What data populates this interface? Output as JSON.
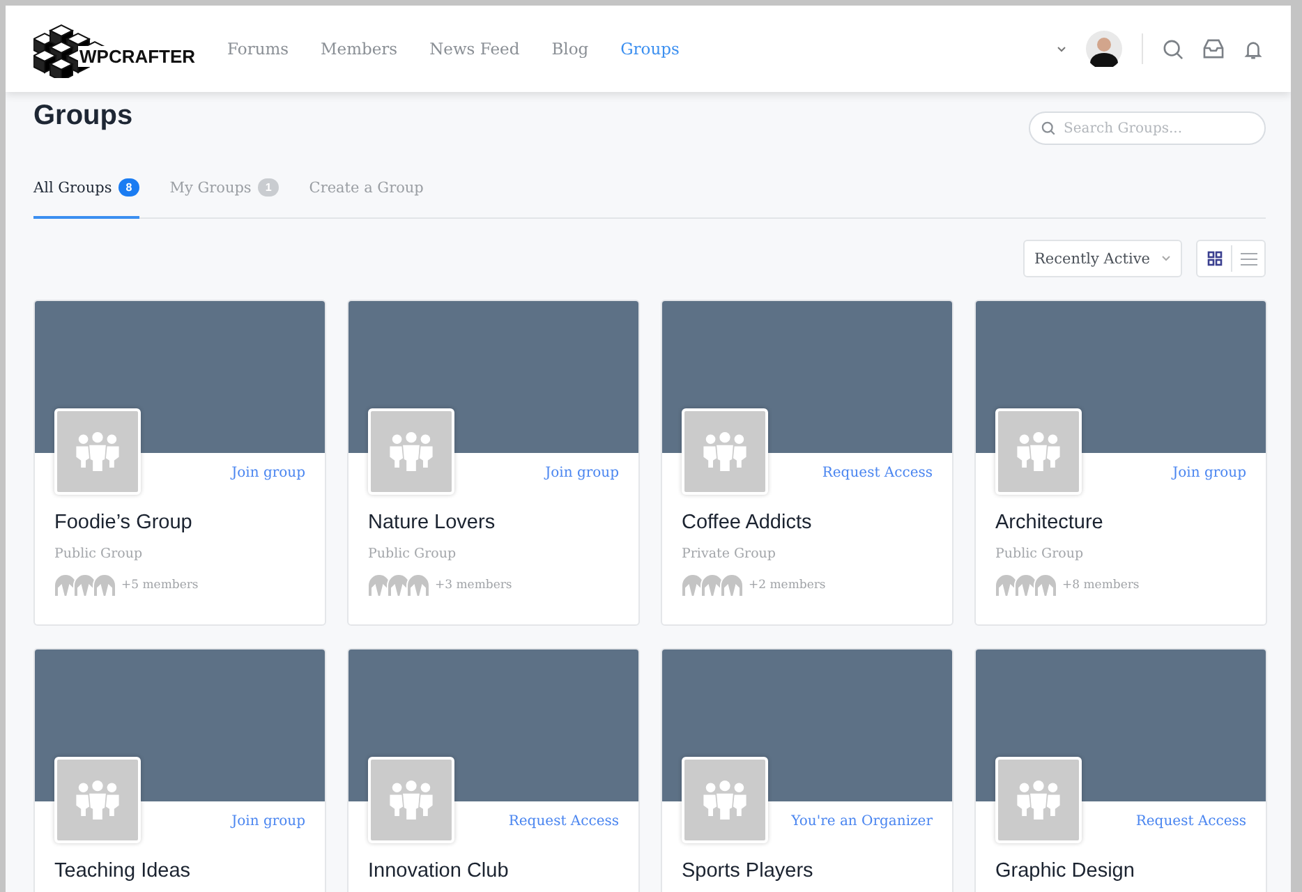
{
  "header": {
    "logo": "WPCRAFTER",
    "nav": [
      {
        "label": "Forums",
        "selected": false
      },
      {
        "label": "Members",
        "selected": false
      },
      {
        "label": "News Feed",
        "selected": false
      },
      {
        "label": "Blog",
        "selected": false
      },
      {
        "label": "Groups",
        "selected": true
      }
    ]
  },
  "page": {
    "title": "Groups",
    "search": {
      "placeholder": "Search Groups..."
    }
  },
  "tabs": [
    {
      "label": "All Groups",
      "count": "8",
      "selected": true
    },
    {
      "label": "My Groups",
      "count": "1",
      "selected": false
    },
    {
      "label": "Create a Group",
      "selected": false
    }
  ],
  "sort": {
    "value": "Recently Active"
  },
  "view_modes": [
    {
      "kind": "grid",
      "selected": true
    },
    {
      "kind": "list",
      "selected": false
    }
  ],
  "groups": [
    {
      "name": "Foodie’s Group",
      "action": "Join group",
      "type": "Public Group",
      "members": "+5 members"
    },
    {
      "name": "Nature Lovers",
      "action": "Join group",
      "type": "Public Group",
      "members": "+3 members"
    },
    {
      "name": "Coffee Addicts",
      "action": "Request Access",
      "type": "Private Group",
      "members": "+2 members"
    },
    {
      "name": "Architecture",
      "action": "Join group",
      "type": "Public Group",
      "members": "+8 members"
    },
    {
      "name": "Teaching Ideas",
      "action": "Join group"
    },
    {
      "name": "Innovation Club",
      "action": "Request Access"
    },
    {
      "name": "Sports Players",
      "action": "You're an Organizer"
    },
    {
      "name": "Graphic Design",
      "action": "Request Access"
    }
  ]
}
